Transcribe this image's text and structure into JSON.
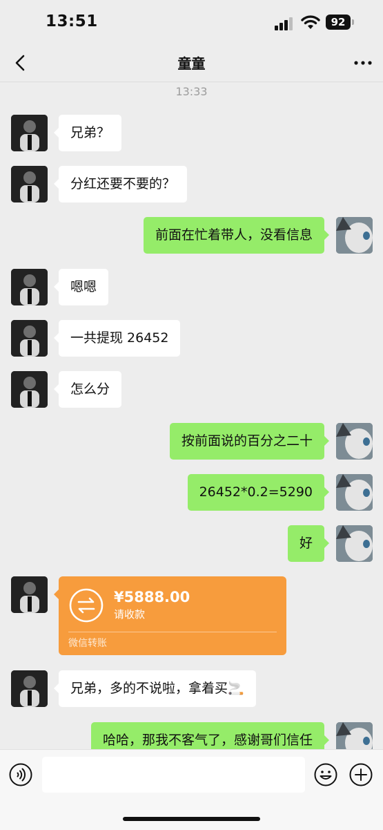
{
  "status_bar": {
    "time": "13:51",
    "battery": "92"
  },
  "header": {
    "title": "童童"
  },
  "timestamp": "13:33",
  "messages": [
    {
      "side": "left",
      "text": "兄弟？"
    },
    {
      "side": "left",
      "text": "分红还要不要的？"
    },
    {
      "side": "right",
      "text": "前面在忙着带人，没看信息"
    },
    {
      "side": "left",
      "text": "嗯嗯"
    },
    {
      "side": "left",
      "text": "一共提现 26452"
    },
    {
      "side": "left",
      "text": "怎么分"
    },
    {
      "side": "right",
      "text": "按前面说的百分之二十"
    },
    {
      "side": "right",
      "text": "26452*0.2=5290"
    },
    {
      "side": "right",
      "text": "好"
    },
    {
      "side": "left",
      "text": "兄弟，多的不说啦，拿着买🚬"
    },
    {
      "side": "right",
      "text": "哈哈，那我不客气了，感谢哥们信任"
    }
  ],
  "transfer": {
    "amount": "¥5888.00",
    "note": "请收款",
    "source": "微信转账"
  },
  "input": {
    "placeholder": ""
  },
  "colors": {
    "background": "#ededed",
    "sent_bubble": "#95ec69",
    "received_bubble": "#ffffff",
    "transfer_card": "#f79c3d"
  }
}
